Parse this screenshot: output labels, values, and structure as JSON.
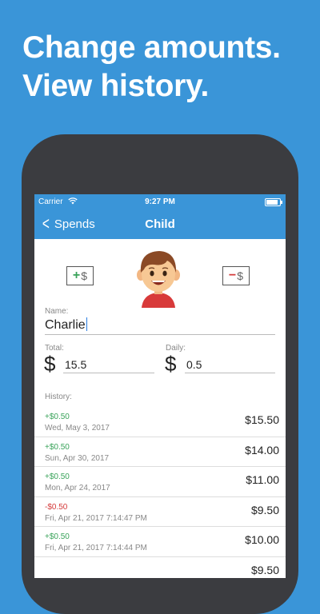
{
  "headline": {
    "line1": "Change amounts.",
    "line2": "View history."
  },
  "status_bar": {
    "carrier": "Carrier",
    "time": "9:27 PM"
  },
  "nav": {
    "back_label": "Spends",
    "title": "Child"
  },
  "buttons": {
    "add_sign": "+",
    "subtract_sign": "−",
    "dollar": "$"
  },
  "form": {
    "name_label": "Name:",
    "name_value": "Charlie",
    "total_label": "Total:",
    "total_value": "15.5",
    "daily_label": "Daily:",
    "daily_value": "0.5",
    "currency_symbol": "$"
  },
  "history": {
    "label": "History:",
    "entries": [
      {
        "delta": "+$0.50",
        "date": "Wed, May 3, 2017",
        "total": "$15.50",
        "type": "positive"
      },
      {
        "delta": "+$0.50",
        "date": "Sun, Apr 30, 2017",
        "total": "$14.00",
        "type": "positive"
      },
      {
        "delta": "+$0.50",
        "date": "Mon, Apr 24, 2017",
        "total": "$11.00",
        "type": "positive"
      },
      {
        "delta": "-$0.50",
        "date": "Fri, Apr 21, 2017 7:14:47 PM",
        "total": "$9.50",
        "type": "negative"
      },
      {
        "delta": "+$0.50",
        "date": "Fri, Apr 21, 2017 7:14:44 PM",
        "total": "$10.00",
        "type": "positive"
      },
      {
        "delta": "",
        "date": "",
        "total": "$9.50",
        "type": "positive"
      }
    ]
  },
  "colors": {
    "brand_blue": "#3a95d8",
    "positive": "#3aa35a",
    "negative": "#d43a3a",
    "phone_body": "#3b3c40"
  }
}
